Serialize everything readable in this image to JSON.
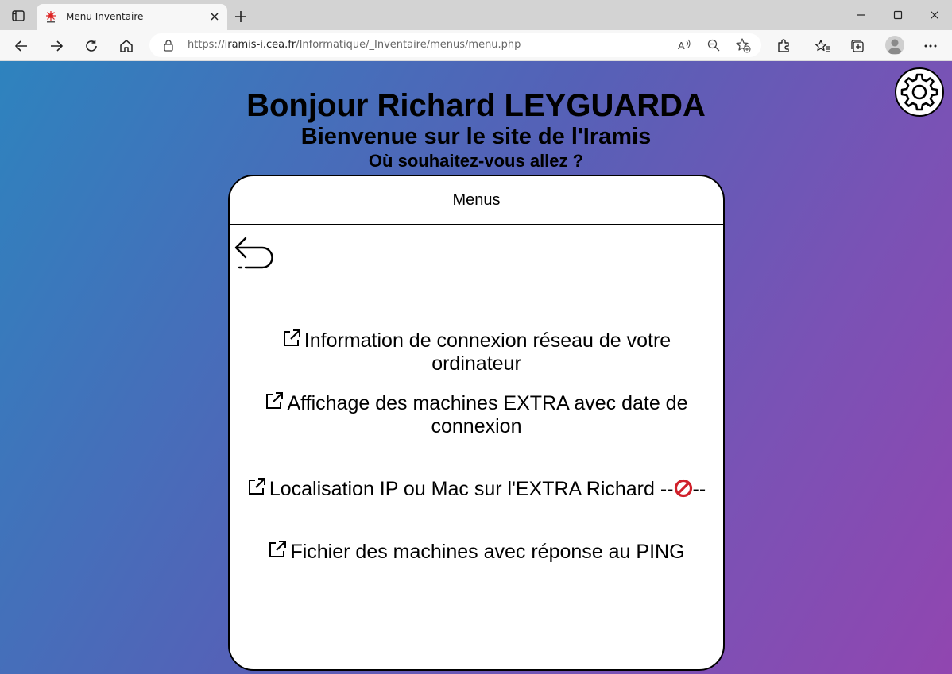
{
  "browser": {
    "tab_title": "Menu Inventaire",
    "url_scheme": "https://",
    "url_host": "iramis-i.cea.fr",
    "url_path": "/Informatique/_Inventaire/menus/menu.php"
  },
  "page": {
    "greeting": "Bonjour Richard LEYGUARDA",
    "welcome": "Bienvenue sur le site de l'Iramis",
    "question": "Où souhaitez-vous allez ?",
    "card_title": "Menus",
    "links": [
      {
        "label": "Information de connexion réseau de votre ordinateur",
        "icon": "external-link-icon"
      },
      {
        "label": "Affichage des machines EXTRA avec date de connexion",
        "icon": "external-link-icon"
      },
      {
        "label_before": "Localisation IP ou Mac sur l'EXTRA Richard --",
        "label_after": "--",
        "icon": "external-link-icon",
        "status_icon": "forbidden-icon"
      },
      {
        "label": "Fichier des machines avec réponse au PING",
        "icon": "external-link-icon"
      }
    ]
  },
  "colors": {
    "gradient_start": "#2e83be",
    "gradient_end": "#9146b0",
    "forbidden": "#d0202a"
  }
}
